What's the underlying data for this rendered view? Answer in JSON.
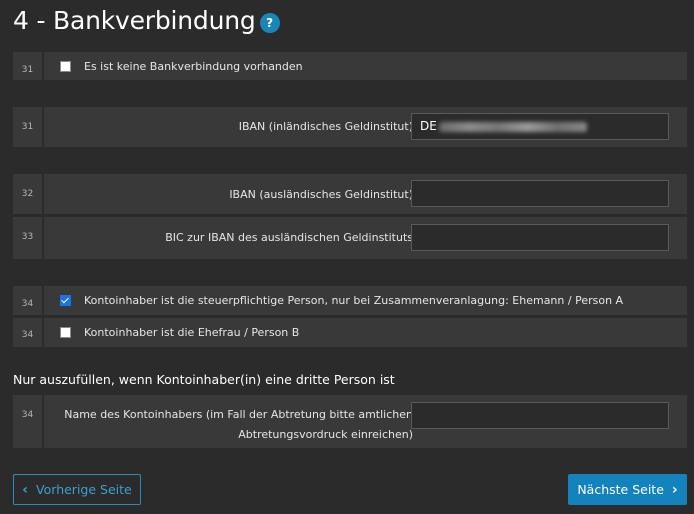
{
  "page": {
    "title": "4 - Bankverbindung",
    "help_icon": "?"
  },
  "rows": {
    "no_bank": {
      "num": "31",
      "label": "Es ist keine Bankverbindung vorhanden",
      "checked": false
    },
    "iban_domestic": {
      "num": "31",
      "label": "IBAN (inländisches Geldinstitut)",
      "value_visible": "DE"
    },
    "iban_foreign": {
      "num": "32",
      "label": "IBAN (ausländisches Geldinstitut)",
      "value": ""
    },
    "bic_foreign": {
      "num": "33",
      "label": "BIC zur IBAN des ausländischen Geldinstituts",
      "value": ""
    },
    "holder_person_a": {
      "num": "34",
      "label": "Kontoinhaber ist die steuerpflichtige Person, nur bei Zusammenveranlagung: Ehemann / Person A",
      "checked": true
    },
    "holder_person_b": {
      "num": "34",
      "label": "Kontoinhaber ist die Ehefrau / Person B",
      "checked": false
    },
    "holder_name": {
      "num": "34",
      "label_line1": "Name des Kontoinhabers (im Fall der Abtretung bitte amtlichen",
      "label_line2": "Abtretungsvordruck einreichen)",
      "value": ""
    }
  },
  "section_third_party": "Nur auszufüllen, wenn Kontoinhaber(in) eine dritte Person ist",
  "nav": {
    "prev_label": "Vorherige Seite",
    "next_label": "Nächste Seite",
    "accent": "#1483bd"
  }
}
